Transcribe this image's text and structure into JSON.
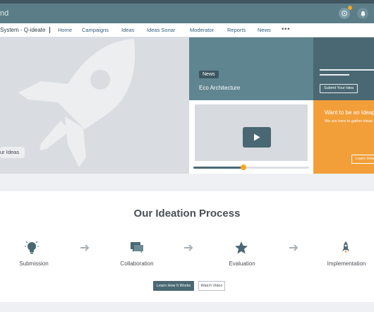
{
  "header": {
    "brand": "nd",
    "icons": {
      "settings": "settings-icon",
      "notifications": "bell-icon"
    },
    "colors": {
      "appbar": "#5b7d88",
      "notification_dot": "#f5a623"
    }
  },
  "nav": {
    "app_title": "System - Q-ideate",
    "items": [
      "Home",
      "Campaigns",
      "Ideas",
      "Ideas Sonar",
      "Moderator",
      "Reports",
      "News"
    ],
    "more": "•••"
  },
  "hero": {
    "pill_text": "ur Ideas",
    "icon": "rocket-icon"
  },
  "news_tile": {
    "badge": "News",
    "title": "Eco Architecture"
  },
  "submit_tile": {
    "button": "Submit Your Idea"
  },
  "video_tile": {
    "icon": "play-icon",
    "progress": 0.43
  },
  "want_tile": {
    "title": "Want to be an Ideap",
    "subtitle": "We are here to gather ideas",
    "button": "Learn How"
  },
  "process": {
    "title": "Our Ideation Process",
    "steps": [
      {
        "label": "Submission",
        "icon": "lightbulb-icon"
      },
      {
        "label": "Collaboration",
        "icon": "chat-icon"
      },
      {
        "label": "Evaluation",
        "icon": "star-icon"
      },
      {
        "label": "Implementation",
        "icon": "rocket-icon"
      }
    ],
    "primary_button": "Learn How It Works",
    "secondary_button": "Watch Video"
  },
  "colors": {
    "accent": "#4a6873",
    "orange": "#f29f3a"
  }
}
